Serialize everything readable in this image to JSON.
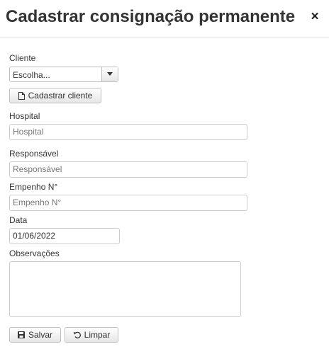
{
  "modal": {
    "title": "Cadastrar consignação permanente",
    "close_glyph": "×"
  },
  "form": {
    "cliente": {
      "label": "Cliente",
      "selected": "Escolha..."
    },
    "cadastrar_cliente_button": "Cadastrar cliente",
    "hospital": {
      "label": "Hospital",
      "placeholder": "Hospital"
    },
    "responsavel": {
      "label": "Responsável",
      "placeholder": "Responsável"
    },
    "empenho": {
      "label": "Empenho N°",
      "placeholder": "Empenho N°"
    },
    "data": {
      "label": "Data",
      "value": "01/06/2022"
    },
    "observacoes": {
      "label": "Observações"
    }
  },
  "actions": {
    "save_label": "Salvar",
    "clear_label": "Limpar"
  },
  "icons": {
    "close": "close-icon",
    "dropdown": "caret-down-icon",
    "new_file": "file-icon",
    "save": "floppy-disk-icon",
    "reset": "undo-icon"
  }
}
